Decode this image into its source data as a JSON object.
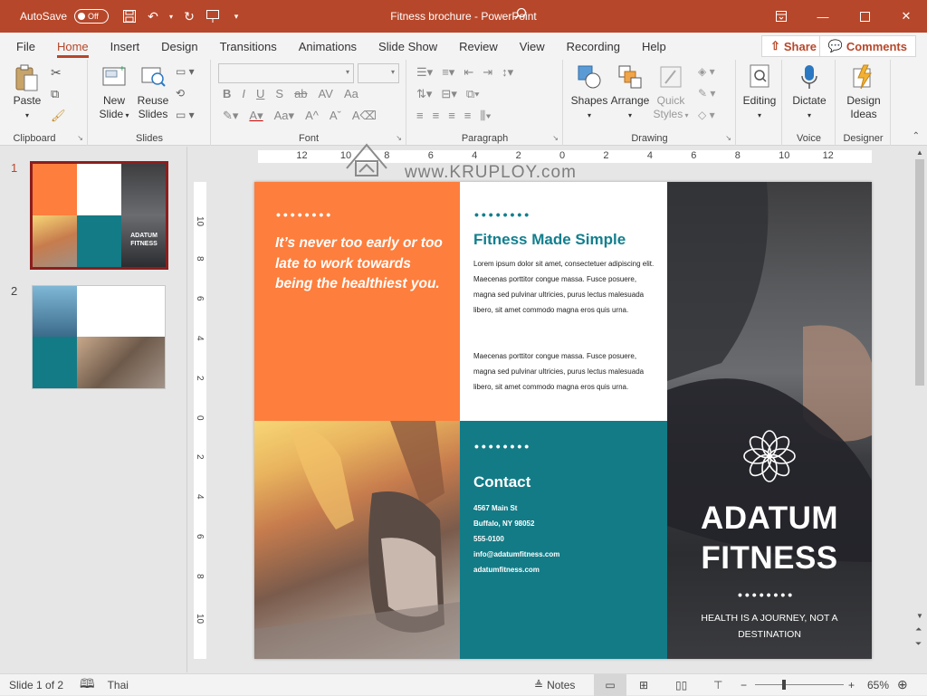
{
  "titlebar": {
    "autosave_label": "AutoSave",
    "autosave_state": "Off",
    "title": "Fitness brochure  -  PowerPoint"
  },
  "tabs": [
    "File",
    "Home",
    "Insert",
    "Design",
    "Transitions",
    "Animations",
    "Slide Show",
    "Review",
    "View",
    "Recording",
    "Help"
  ],
  "active_tab": "Home",
  "share_label": "Share",
  "comments_label": "Comments",
  "ribbon": {
    "clipboard": {
      "label": "Clipboard",
      "paste": "Paste"
    },
    "slides": {
      "label": "Slides",
      "new_slide_1": "New",
      "new_slide_2": "Slide",
      "reuse_1": "Reuse",
      "reuse_2": "Slides"
    },
    "font": {
      "label": "Font"
    },
    "paragraph": {
      "label": "Paragraph"
    },
    "drawing": {
      "label": "Drawing",
      "shapes": "Shapes",
      "arrange": "Arrange",
      "quick_1": "Quick",
      "quick_2": "Styles"
    },
    "editing": {
      "label": "Editing"
    },
    "voice": {
      "label": "Voice",
      "dictate": "Dictate"
    },
    "designer": {
      "label": "Designer",
      "ideas_1": "Design",
      "ideas_2": "Ideas"
    }
  },
  "thumbnails": [
    {
      "number": "1"
    },
    {
      "number": "2"
    }
  ],
  "ruler_h_labels": [
    "12",
    "10",
    "8",
    "6",
    "4",
    "2",
    "0",
    "2",
    "4",
    "6",
    "8",
    "10",
    "12"
  ],
  "ruler_v_labels": [
    "10",
    "8",
    "6",
    "4",
    "2",
    "0",
    "2",
    "4",
    "6",
    "8",
    "10"
  ],
  "watermark": "www.KRUPLOY.com",
  "slide": {
    "dots": "••••••••",
    "quote": "It’s never too early or too late to work towards being the healthiest you.",
    "heading": "Fitness Made Simple",
    "para1": "Lorem ipsum dolor sit amet, consectetuer adipiscing elit. Maecenas porttitor congue massa. Fusce posuere, magna sed pulvinar ultricies, purus lectus malesuada libero, sit amet commodo magna eros quis urna.",
    "para2": "Maecenas porttitor congue massa. Fusce posuere, magna sed pulvinar ultricies, purus lectus malesuada libero, sit amet commodo magna eros quis urna.",
    "contact_heading": "Contact",
    "contact": {
      "address1": "4567 Main St",
      "address2": "Buffalo, NY 98052",
      "phone": "555-0100",
      "email": "info@adatumfitness.com",
      "web": "adatumfitness.com"
    },
    "brand_line1": "ADATUM",
    "brand_line2": "FITNESS",
    "tagline": "HEALTH IS A JOURNEY, NOT A DESTINATION"
  },
  "thumb1": {
    "brand_line1": "ADATUM",
    "brand_line2": "FITNESS"
  },
  "status": {
    "slide_info": "Slide 1 of 2",
    "language": "Thai",
    "notes": "Notes",
    "zoom": "65%"
  },
  "colors": {
    "accent": "#b7472a",
    "orange": "#fd7e3d",
    "teal": "#137b86",
    "heading_teal": "#127f8e"
  }
}
